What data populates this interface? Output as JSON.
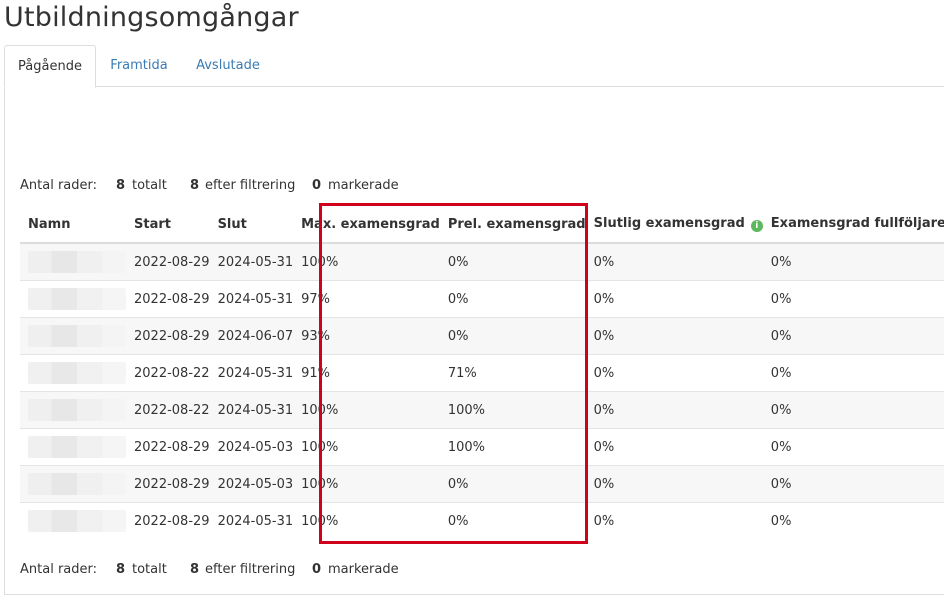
{
  "page": {
    "title": "Utbildningsomgångar"
  },
  "tabs": [
    {
      "label": "Pågående",
      "active": true
    },
    {
      "label": "Framtida",
      "active": false
    },
    {
      "label": "Avslutade",
      "active": false
    }
  ],
  "rows_info": {
    "label": "Antal rader:",
    "total": "8",
    "total_label": "totalt",
    "filtered": "8",
    "filtered_label": "efter filtrering",
    "marked": "0",
    "marked_label": "markerade"
  },
  "table": {
    "columns": [
      {
        "label": "Namn",
        "info": false
      },
      {
        "label": "Start",
        "info": false
      },
      {
        "label": "Slut",
        "info": false
      },
      {
        "label": "Max. examensgrad",
        "info": false
      },
      {
        "label": "Prel. examensgrad",
        "info": false
      },
      {
        "label": "Slutlig examensgrad",
        "info": true
      },
      {
        "label": "Examensgrad fullföljare",
        "info": true
      }
    ],
    "rows": [
      [
        "2022-08-29",
        "2024-05-31",
        "100%",
        "0%",
        "0%",
        "0%"
      ],
      [
        "2022-08-29",
        "2024-05-31",
        "97%",
        "0%",
        "0%",
        "0%"
      ],
      [
        "2022-08-29",
        "2024-06-07",
        "93%",
        "0%",
        "0%",
        "0%"
      ],
      [
        "2022-08-22",
        "2024-05-31",
        "91%",
        "71%",
        "0%",
        "0%"
      ],
      [
        "2022-08-22",
        "2024-05-31",
        "100%",
        "100%",
        "0%",
        "0%"
      ],
      [
        "2022-08-29",
        "2024-05-03",
        "100%",
        "100%",
        "0%",
        "0%"
      ],
      [
        "2022-08-29",
        "2024-05-03",
        "100%",
        "0%",
        "0%",
        "0%"
      ],
      [
        "2022-08-29",
        "2024-05-31",
        "100%",
        "0%",
        "0%",
        "0%"
      ]
    ]
  },
  "colors": {
    "highlight": "#d0021b",
    "link": "#3a7bb3",
    "info_icon": "#5cb85c"
  }
}
